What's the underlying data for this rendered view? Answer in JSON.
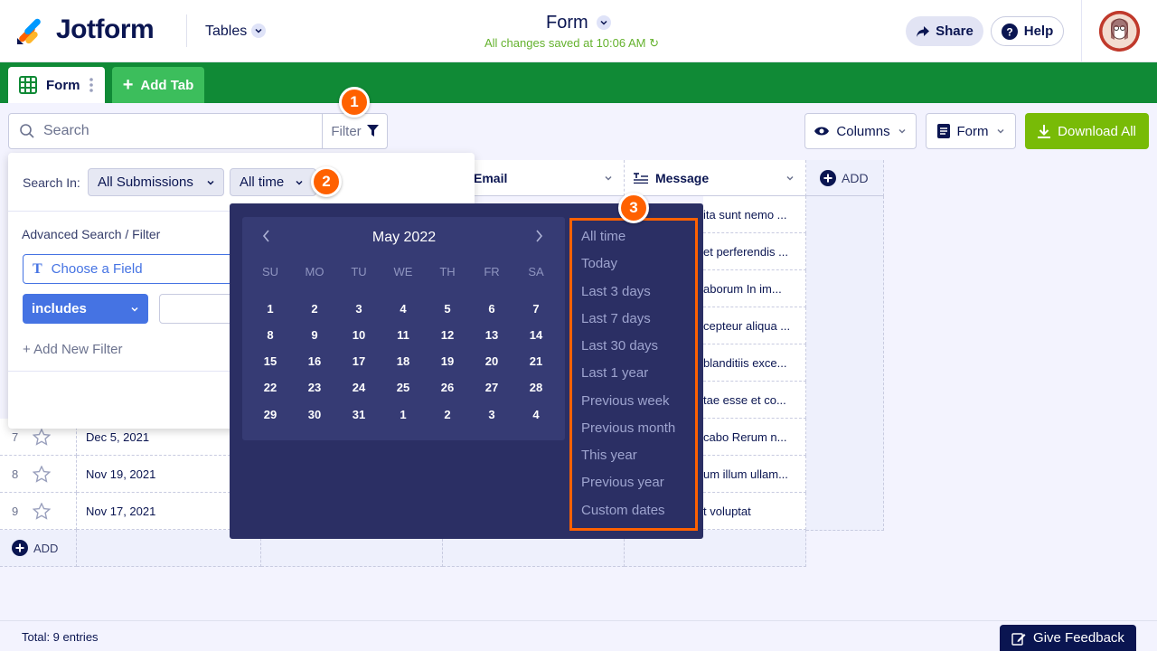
{
  "header": {
    "logo_text": "Jotform",
    "tables_label": "Tables",
    "form_title": "Form",
    "saved_status": "All changes saved at 10:06 AM",
    "share_label": "Share",
    "help_label": "Help"
  },
  "tabs": {
    "form_label": "Form",
    "add_label": "Add Tab"
  },
  "toolbar": {
    "search_placeholder": "Search",
    "filter_label": "Filter",
    "columns_label": "Columns",
    "form_select_label": "Form",
    "download_label": "Download All"
  },
  "table": {
    "columns": [
      "Email",
      "Message"
    ],
    "add_column_label": "ADD",
    "add_row_label": "ADD",
    "messages": [
      "ita sunt nemo ...",
      "et perferendis ...",
      "aborum In im...",
      "cepteur aliqua ...",
      "blanditiis exce...",
      "tae esse et co...",
      "cabo Rerum n...",
      "um illum ullam...",
      "t voluptat"
    ],
    "visible_rows": [
      {
        "num": "7",
        "date": "Dec 5, 2021"
      },
      {
        "num": "8",
        "date": "Nov 19, 2021"
      },
      {
        "num": "9",
        "date": "Nov 17, 2021"
      }
    ]
  },
  "filter_panel": {
    "search_in_label": "Search In:",
    "scope_value": "All Submissions",
    "time_value": "All time",
    "advanced_label": "Advanced Search / Filter",
    "field_placeholder": "Choose a Field",
    "operator_value": "includes",
    "add_filter_label": "+ Add New Filter"
  },
  "date_picker": {
    "month": "May 2022",
    "weekdays": [
      "SU",
      "MO",
      "TU",
      "WE",
      "TH",
      "FR",
      "SA"
    ],
    "weeks": [
      [
        "1",
        "2",
        "3",
        "4",
        "5",
        "6",
        "7"
      ],
      [
        "8",
        "9",
        "10",
        "11",
        "12",
        "13",
        "14"
      ],
      [
        "15",
        "16",
        "17",
        "18",
        "19",
        "20",
        "21"
      ],
      [
        "22",
        "23",
        "24",
        "25",
        "26",
        "27",
        "28"
      ],
      [
        "29",
        "30",
        "31",
        "1",
        "2",
        "3",
        "4"
      ]
    ],
    "presets": [
      "All time",
      "Today",
      "Last 3 days",
      "Last 7 days",
      "Last 30 days",
      "Last 1 year",
      "Previous week",
      "Previous month",
      "This year",
      "Previous year",
      "Custom dates"
    ]
  },
  "annotations": {
    "badge_1": "1",
    "badge_2": "2",
    "badge_3": "3"
  },
  "footer": {
    "total_text": "Total: 9 entries",
    "feedback_label": "Give Feedback"
  },
  "colors": {
    "tab_bar": "#108a36",
    "download": "#78bb07",
    "datepicker_bg": "#2b2f64",
    "highlight": "#ff6100",
    "accent_blue": "#4573e3"
  }
}
